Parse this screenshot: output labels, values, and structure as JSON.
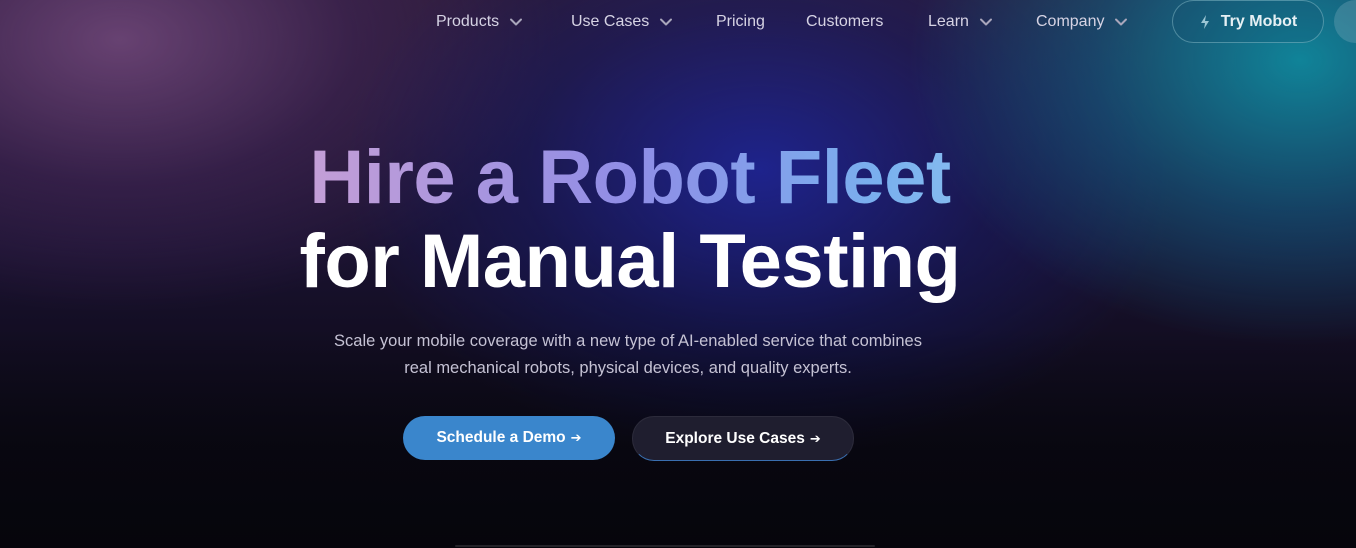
{
  "nav": {
    "items": [
      {
        "label": "Products",
        "dropdown": true
      },
      {
        "label": "Use Cases",
        "dropdown": true
      },
      {
        "label": "Pricing",
        "dropdown": false
      },
      {
        "label": "Customers",
        "dropdown": false
      },
      {
        "label": "Learn",
        "dropdown": true
      },
      {
        "label": "Company",
        "dropdown": true
      }
    ],
    "cta": {
      "label": "Try Mobot",
      "icon": "bolt-icon"
    }
  },
  "hero": {
    "line1_words": [
      "Hire",
      "a",
      "Robot",
      "Fleet"
    ],
    "line2": "for Manual Testing",
    "subtitle_line1": "Scale your mobile coverage with a new type of AI-enabled service that combines",
    "subtitle_line2": "real mechanical robots, physical devices, and quality experts.",
    "primary_button": {
      "label": "Schedule a Demo",
      "arrow": "➔"
    },
    "secondary_button": {
      "label": "Explore Use Cases",
      "arrow": "➔"
    }
  },
  "colors": {
    "primary_button": "#3a86cc",
    "secondary_button": "#1f1e2f",
    "gradient_start": "#e9b9d4",
    "gradient_end": "#b5e6f6"
  }
}
